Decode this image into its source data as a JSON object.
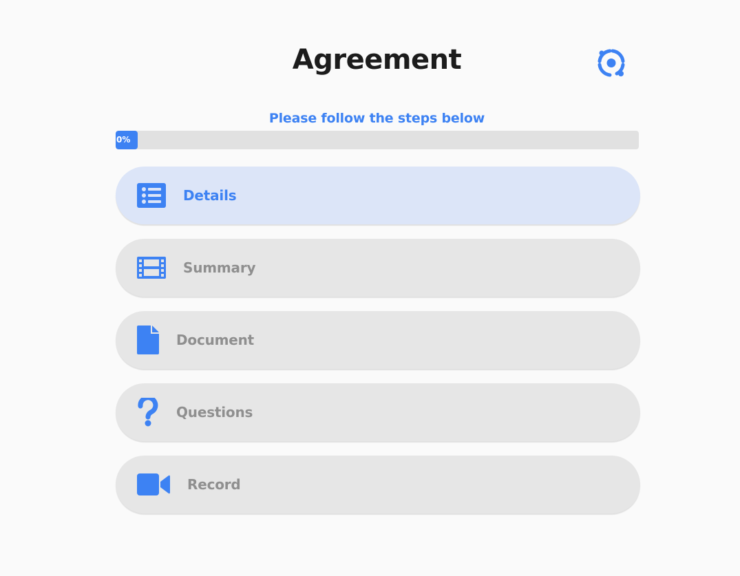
{
  "header": {
    "title": "Agreement",
    "corner_icon": "focus-scan-icon"
  },
  "subtitle": "Please follow the steps below",
  "progress": {
    "value": 0,
    "label": "0%"
  },
  "steps": [
    {
      "label": "Details",
      "icon": "list-icon",
      "active": true
    },
    {
      "label": "Summary",
      "icon": "film-icon",
      "active": false
    },
    {
      "label": "Document",
      "icon": "file-icon",
      "active": false
    },
    {
      "label": "Questions",
      "icon": "question-mark-icon",
      "active": false
    },
    {
      "label": "Record",
      "icon": "video-camera-icon",
      "active": false
    }
  ],
  "colors": {
    "accent": "#3d82f3",
    "active_step_bg": "#dce5f8",
    "step_bg": "#e6e6e6",
    "inactive_text": "#8f8f8f",
    "title_text": "#1c1c1c",
    "track": "#e1e1e1",
    "page_bg": "#fafafa"
  }
}
